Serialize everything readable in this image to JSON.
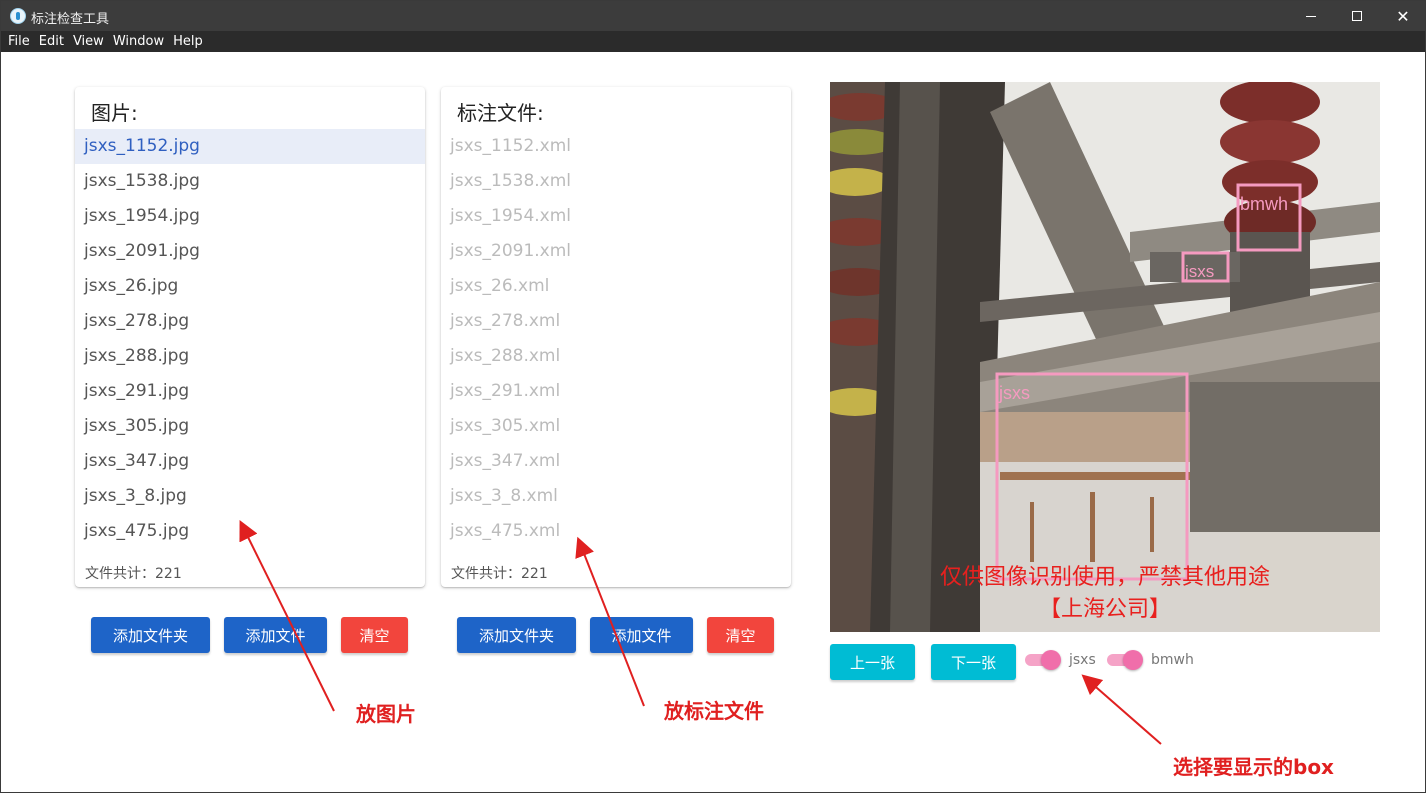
{
  "window": {
    "title": "标注检查工具",
    "controls": [
      "minimize",
      "maximize",
      "close"
    ]
  },
  "menu": [
    "File",
    "Edit",
    "View",
    "Window",
    "Help"
  ],
  "images_panel": {
    "title": "图片:",
    "items": [
      "jsxs_1152.jpg",
      "jsxs_1538.jpg",
      "jsxs_1954.jpg",
      "jsxs_2091.jpg",
      "jsxs_26.jpg",
      "jsxs_278.jpg",
      "jsxs_288.jpg",
      "jsxs_291.jpg",
      "jsxs_305.jpg",
      "jsxs_347.jpg",
      "jsxs_3_8.jpg",
      "jsxs_475.jpg"
    ],
    "selected_index": 0,
    "count_label": "文件共计：221",
    "buttons": {
      "add_folder": "添加文件夹",
      "add_file": "添加文件",
      "clear": "清空"
    }
  },
  "annotations_panel": {
    "title": "标注文件:",
    "items": [
      "jsxs_1152.xml",
      "jsxs_1538.xml",
      "jsxs_1954.xml",
      "jsxs_2091.xml",
      "jsxs_26.xml",
      "jsxs_278.xml",
      "jsxs_288.xml",
      "jsxs_291.xml",
      "jsxs_305.xml",
      "jsxs_347.xml",
      "jsxs_3_8.xml",
      "jsxs_475.xml"
    ],
    "count_label": "文件共计：221",
    "buttons": {
      "add_folder": "添加文件夹",
      "add_file": "添加文件",
      "clear": "清空"
    }
  },
  "viewer": {
    "boxes": [
      {
        "label": "bmwh"
      },
      {
        "label": "jsxs"
      },
      {
        "label": "jsxs"
      }
    ],
    "watermark_line1": "仅供图像识别使用，严禁其他用途",
    "watermark_line2": "【上海公司】",
    "box_color": "#f59ac0"
  },
  "navigation": {
    "prev": "上一张",
    "next": "下一张"
  },
  "filters": [
    {
      "label": "jsxs",
      "on": true
    },
    {
      "label": "bmwh",
      "on": true
    }
  ],
  "callouts": {
    "images": "放图片",
    "annotations": "放标注文件",
    "filters": "选择要显示的box"
  },
  "colors": {
    "primary": "#1e64c8",
    "danger": "#f2453d",
    "nav": "#00bcd4",
    "toggle": "#f06eaa",
    "callout": "#e02020"
  }
}
